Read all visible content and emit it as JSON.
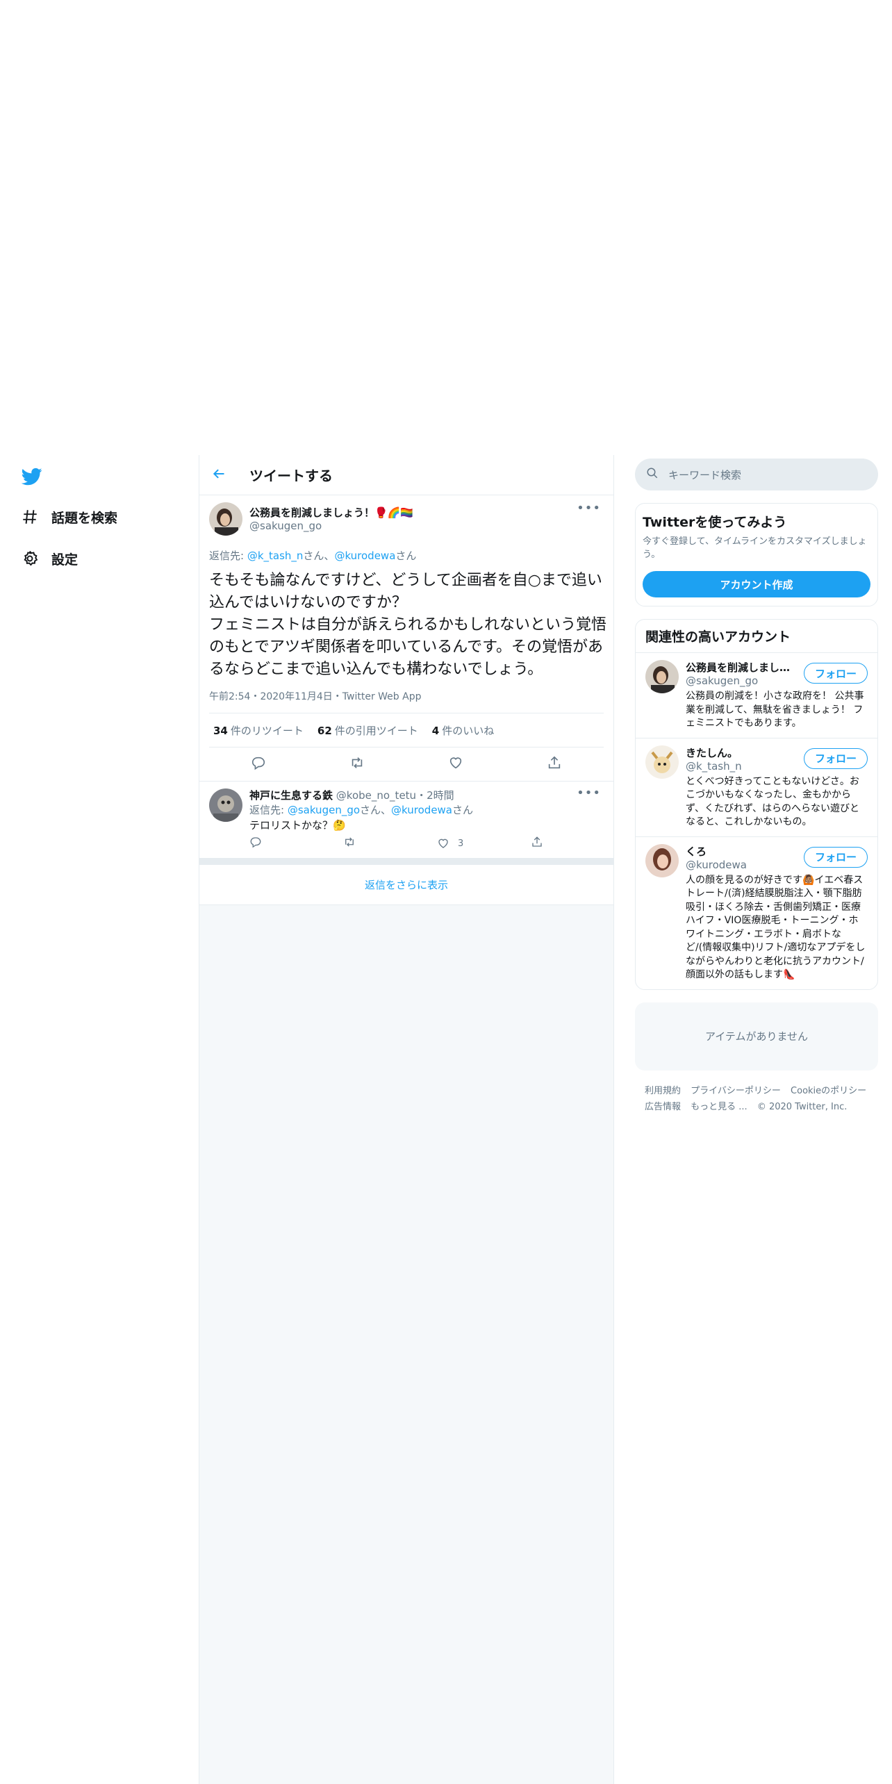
{
  "nav": {
    "items": [
      {
        "label": "話題を検索",
        "icon": "hashtag-icon"
      },
      {
        "label": "設定",
        "icon": "gear-icon"
      }
    ]
  },
  "header": {
    "title": "ツイートする"
  },
  "tweet": {
    "name": "公務員を削減しましょう！",
    "name_emoji": "🥊🌈🏳️‍🌈",
    "handle": "@sakugen_go",
    "reply_prefix": "返信先: ",
    "reply_user1": "@k_tash_n",
    "reply_san1": "さん、",
    "reply_user2": "@kurodewa",
    "reply_san2": "さん",
    "text": "そもそも論なんですけど、どうして企画者を自○まで追い込んではいけないのですか？\nフェミニストは自分が訴えられるかもしれないという覚悟のもとでアツギ関係者を叩いているんです。その覚悟があるならどこまで追い込んでも構わないでしょう。",
    "meta": "午前2:54・2020年11月4日・Twitter Web App",
    "retweets_count": "34",
    "retweets_label": "件のリツイート",
    "quotes_count": "62",
    "quotes_label": "件の引用ツイート",
    "likes_count": "4",
    "likes_label": "件のいいね"
  },
  "reply": {
    "name": "神戸に生息する鉄",
    "handle": "@kobe_no_tetu",
    "time": "・2時間",
    "reply_prefix": "返信先: ",
    "reply_user1": "@sakugen_go",
    "reply_san1": "さん、",
    "reply_user2": "@kurodewa",
    "reply_san2": "さん",
    "text": "テロリストかな？🤔",
    "likes": "3"
  },
  "show_more": "返信をさらに表示",
  "sidebar": {
    "search_placeholder": "キーワード検索",
    "signup": {
      "title": "Twitterを使ってみよう",
      "desc": "今すぐ登録して、タイムラインをカスタマイズしましょう。",
      "button": "アカウント作成"
    },
    "related": {
      "title": "関連性の高いアカウント",
      "follow_label": "フォロー",
      "accounts": [
        {
          "name": "公務員を削減しましょう！🥊🌈🏳️‍🌈",
          "handle": "@sakugen_go",
          "bio": "公務員の削減を！小さな政府を！ 公共事業を削減して、無駄を省きましょう！ フェミニストでもあります。"
        },
        {
          "name": "きたしん。",
          "handle": "@k_tash_n",
          "bio": "とくべつ好きってこともないけどさ。おこづかいもなくなったし、金もかからず、くたびれず、はらのへらない遊びとなると、これしかないもの。"
        },
        {
          "name": "くろ",
          "handle": "@kurodewa",
          "bio": "人の顔を見るのが好きです🙆🏽イエベ春ストレート/(済)経結膜脱脂注入・顎下脂肪吸引・ほくろ除去・舌側歯列矯正・医療ハイフ・VIO医療脱毛・トーニング・ホワイトニング・エラボト・肩ボトなど/(情報収集中)リフト/適切なアプデをしながらやんわりと老化に抗うアカウント/顔面以外の話もします👠"
        }
      ]
    },
    "trends_empty": "アイテムがありません",
    "footer": {
      "links_row1": [
        "利用規約",
        "プライバシーポリシー",
        "Cookieのポリシー"
      ],
      "links_row2": [
        "広告情報",
        "もっと見る ..."
      ],
      "copyright": "© 2020 Twitter, Inc."
    }
  },
  "colors": {
    "accent": "#1da1f2",
    "text": "#14171a",
    "secondary": "#657786",
    "border": "#e6ecf0",
    "background": "#f5f8fa"
  }
}
